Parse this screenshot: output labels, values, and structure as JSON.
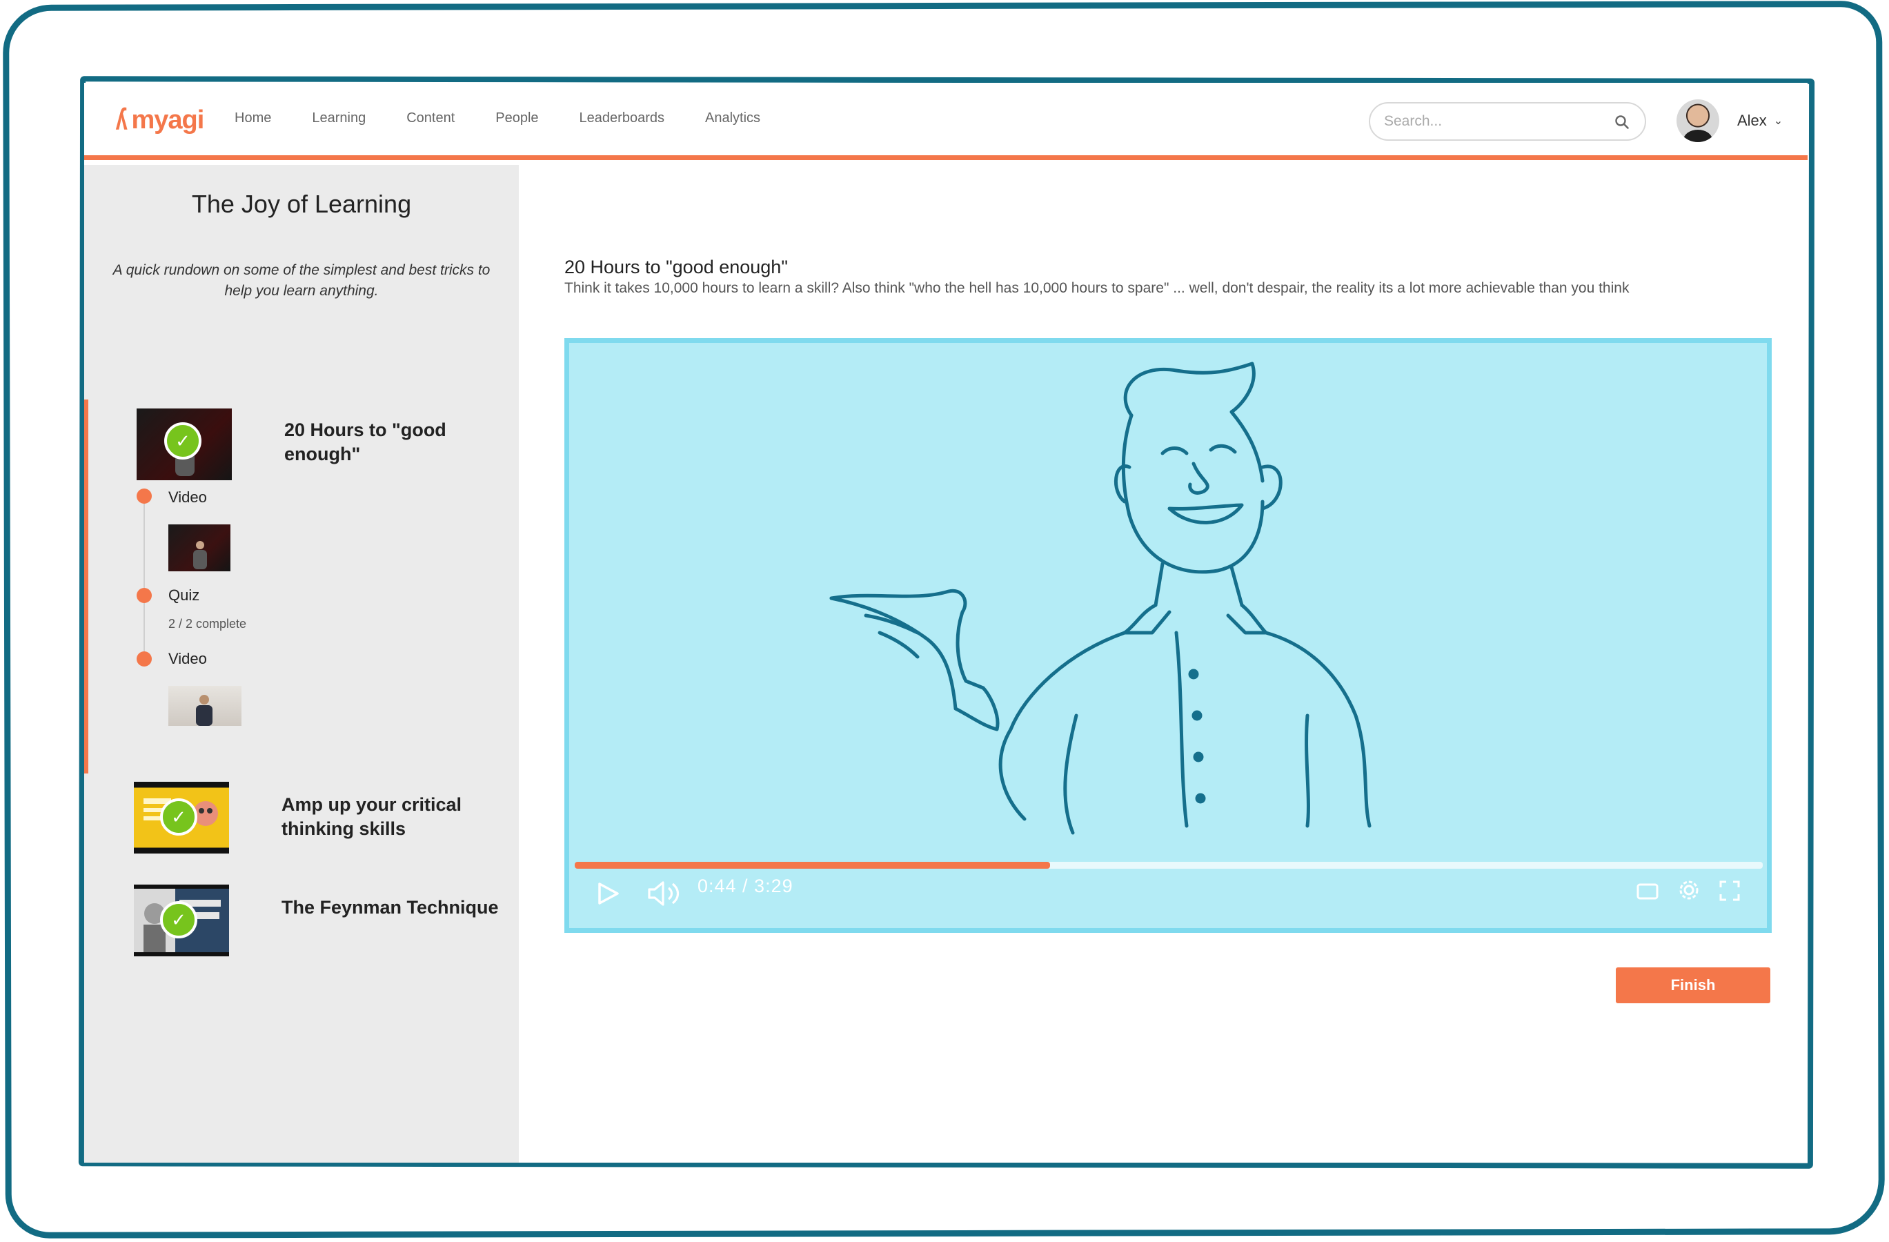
{
  "app": {
    "logo_text": "myagi"
  },
  "nav": [
    {
      "label": "Home"
    },
    {
      "label": "Learning"
    },
    {
      "label": "Content"
    },
    {
      "label": "People"
    },
    {
      "label": "Leaderboards"
    },
    {
      "label": "Analytics"
    }
  ],
  "search": {
    "placeholder": "Search...",
    "value": ""
  },
  "user": {
    "name": "Alex"
  },
  "course": {
    "title": "The Joy of Learning",
    "description": "A quick rundown on some of the simplest and best tricks to help you learn anything.",
    "modules": [
      {
        "title": "20 Hours to \"good enough\"",
        "completed": true,
        "steps": [
          {
            "type": "Video"
          },
          {
            "type": "Quiz",
            "progress": "2 / 2 complete"
          },
          {
            "type": "Video"
          }
        ]
      },
      {
        "title": "Amp up your critical thinking skills",
        "completed": true
      },
      {
        "title": "The Feynman Technique",
        "completed": true
      }
    ]
  },
  "lesson": {
    "title": "20 Hours to \"good enough\"",
    "description": "Think it takes 10,000 hours to learn a skill? Also think \"who the hell has 10,000 hours to spare\" ... well, don't despair, the reality its a lot more achievable than you think"
  },
  "player": {
    "time": "0:44 / 3:29",
    "progress": 0.4,
    "colors": {
      "background": "#b4ecf6",
      "progress": "#f4774a",
      "stroke": "#156f8c"
    }
  },
  "actions": {
    "finish_label": "Finish"
  },
  "colors": {
    "accent": "#f4774a",
    "frame": "#126b83",
    "check": "#77c41d"
  }
}
